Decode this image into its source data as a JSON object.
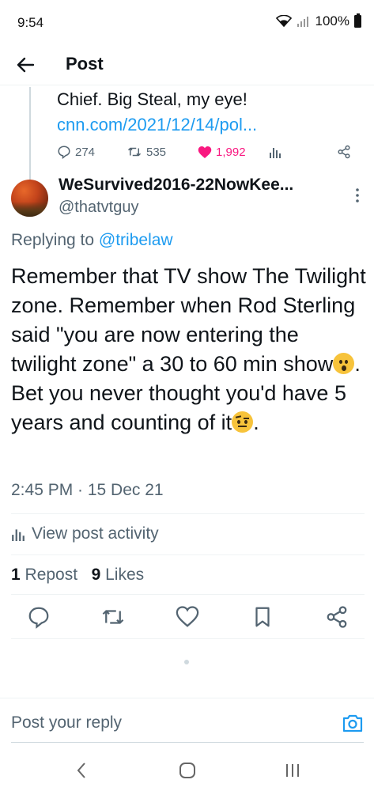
{
  "status": {
    "time": "9:54",
    "battery": "100%"
  },
  "header": {
    "title": "Post"
  },
  "quoted": {
    "text": "Chief. Big Steal, my eye!",
    "link": "cnn.com/2021/12/14/pol...",
    "replies": "274",
    "reposts": "535",
    "likes": "1,992"
  },
  "post": {
    "author_name": "WeSurvived2016-22NowKee...",
    "handle": "@thatvtguy",
    "replying_prefix": "Replying to",
    "replying_to": "@tribelaw",
    "text_part1": "Remember that TV show The Twilight zone. Remember when Rod Sterling said \"you are now entering the twilight zone\" a 30 to 60 min show",
    "text_part2": ". Bet you never thought you'd have 5 years and counting of it",
    "text_part3": ".",
    "emoji1": "hushed-face-emoji",
    "emoji2": "face-with-raised-eyebrow-emoji",
    "timestamp": "2:45 PM · 15 Dec 21",
    "view_activity": "View post activity",
    "repost_count": "1",
    "repost_label": "Repost",
    "likes_count": "9",
    "likes_label": "Likes"
  },
  "reply_bar": {
    "placeholder": "Post your reply"
  },
  "colors": {
    "accent": "#1d9bf0",
    "like": "#f91880",
    "muted": "#536471",
    "text": "#0f1419"
  },
  "icons": [
    "back-arrow-icon",
    "reply-icon",
    "repost-icon",
    "like-icon",
    "views-icon",
    "share-icon",
    "bookmark-icon",
    "more-icon",
    "camera-icon"
  ]
}
